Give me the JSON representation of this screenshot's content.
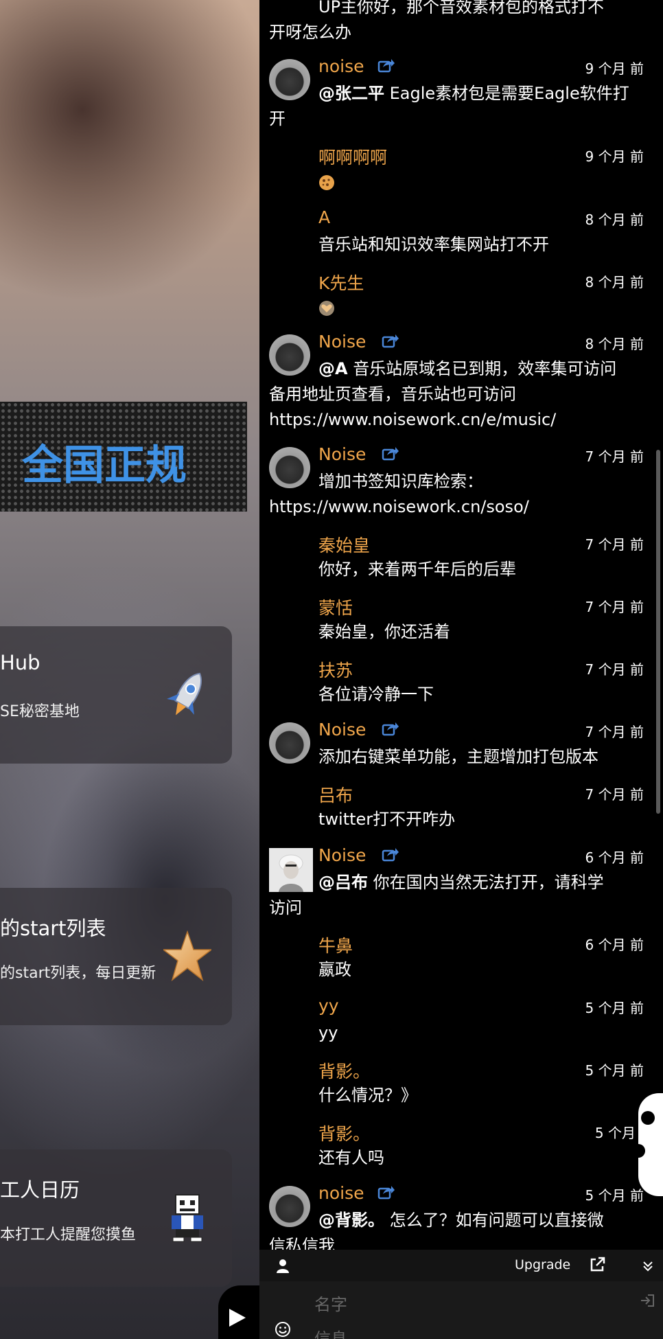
{
  "background": {
    "banner_text": "：全国正规",
    "cards": [
      {
        "title": "Hub",
        "desc": "SE秘密基地",
        "icon": "rocket-icon"
      },
      {
        "title": "的start列表",
        "desc": "的start列表，每日更新",
        "icon": "star-icon"
      },
      {
        "title": "工人日历",
        "desc": "本打工人提醒您摸鱼",
        "icon": "pixel-skeleton-icon"
      }
    ]
  },
  "comments": {
    "top_cut": [
      "UP主你好，那个音效素材包的格式打不",
      "开呀怎么办"
    ],
    "items": [
      {
        "name": "noise",
        "time": "9 个月 前",
        "mention": "@张二平",
        "line1": " Eagle素材包是需要Eagle软件打",
        "line2": "开"
      },
      {
        "name": "啊啊啊啊",
        "time": "9 个月 前"
      },
      {
        "name": "A",
        "time": "8 个月 前",
        "text": "音乐站和知识效率集网站打不开"
      },
      {
        "name": "K先生",
        "time": "8 个月 前"
      },
      {
        "name": "Noise",
        "time": "8 个月 前",
        "mention": "@A",
        "line1": " 音乐站原域名已到期，效率集可访问",
        "line2": "备用地址页查看，音乐站也可访问",
        "line3": "https://www.noisework.cn/e/music/"
      },
      {
        "name": "Noise",
        "time": "7 个月 前",
        "line1": "增加书签知识库检索：",
        "line2": "https://www.noisework.cn/soso/"
      },
      {
        "name": "秦始皇",
        "time": "7 个月 前",
        "text": "你好，来着两千年后的后辈"
      },
      {
        "name": "蒙恬",
        "time": "7 个月 前",
        "text": "秦始皇，你还活着"
      },
      {
        "name": "扶苏",
        "time": "7 个月 前",
        "text": "各位请冷静一下"
      },
      {
        "name": "Noise",
        "time": "7 个月 前",
        "text": "添加右键菜单功能，主题增加打包版本"
      },
      {
        "name": "吕布",
        "time": "7 个月 前",
        "text": "twitter打不开咋办"
      },
      {
        "name": "Noise",
        "time": "6 个月 前",
        "mention": "@吕布",
        "line1": " 你在国内当然无法打开，请科学",
        "line2": "访问"
      },
      {
        "name": "牛鼻",
        "time": "6 个月 前",
        "text": "嬴政"
      },
      {
        "name": "yy",
        "time": "5 个月 前",
        "text": "yy"
      },
      {
        "name": "背影。",
        "time": "5 个月 前",
        "text": "什么情况？》"
      },
      {
        "name": "背影。",
        "time": "5 个月",
        "text": "还有人吗"
      },
      {
        "name": "noise",
        "time": "5 个月 前",
        "mention": "@背影。",
        "line1": " 怎么了？如有问题可以直接微",
        "line2": "信私信我"
      }
    ]
  },
  "input_bar": {
    "upgrade_label": "Upgrade",
    "name_placeholder": "名字",
    "message_placeholder": "信息"
  },
  "colors": {
    "name": "#f0a64b",
    "panel_bg": "#000000",
    "banner_text": "#3f92e6"
  }
}
